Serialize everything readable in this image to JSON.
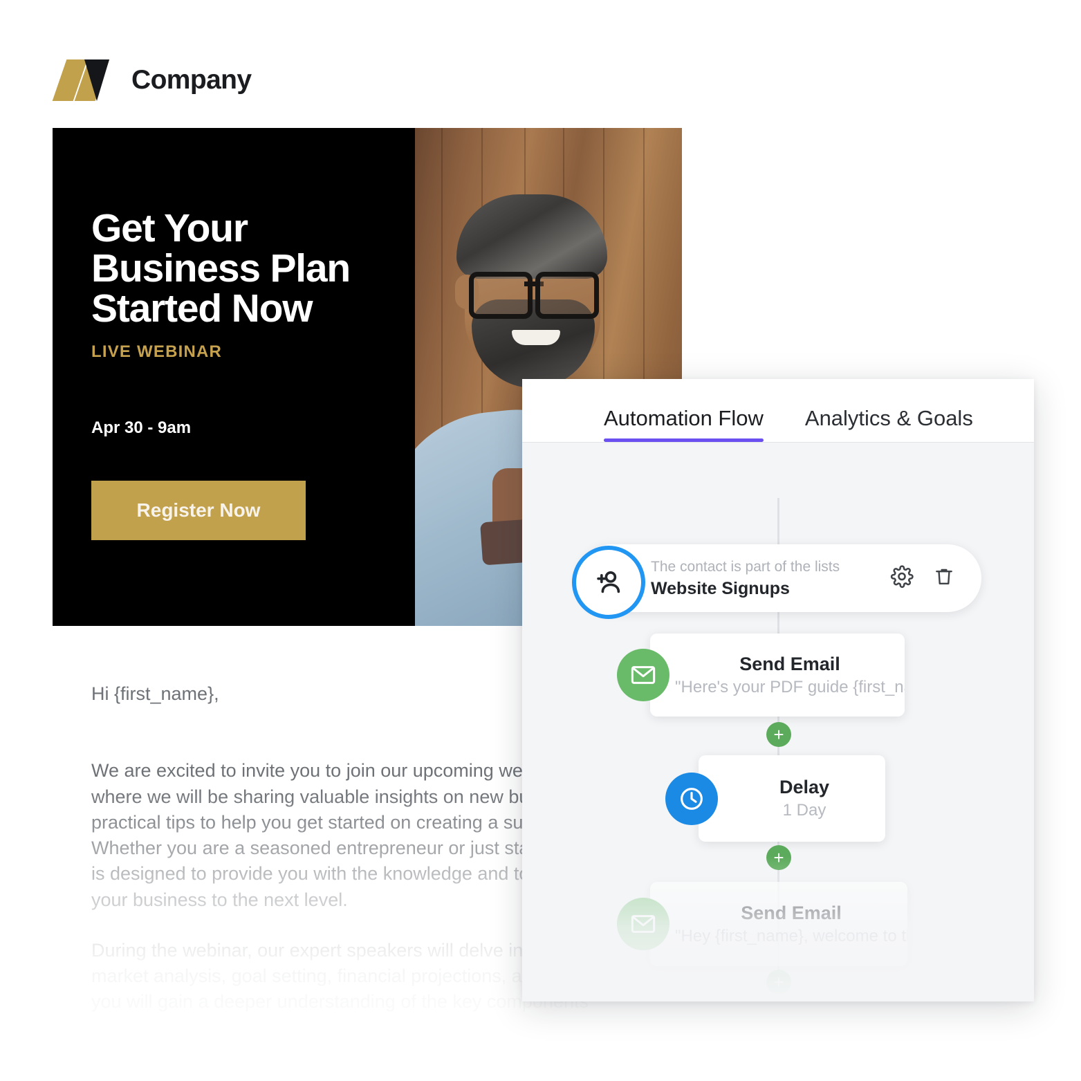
{
  "brand": {
    "name": "Company",
    "logo_gold": "#c2a14d",
    "logo_dark": "#15161a"
  },
  "email": {
    "hero": {
      "heading": "Get Your\nBusiness\nPlan Started\nNow",
      "kicker": "LIVE WEBINAR",
      "date": "Apr 30 - 9am",
      "cta_label": "Register Now",
      "cta_color": "#c2a14d",
      "background": "#000000"
    },
    "body": {
      "greeting": "Hi {first_name},",
      "paragraph_1": "We are excited to invite you to join our upcoming webinar on\nwhere we will be sharing valuable insights on new business\npractical tips to help you get started on creating a successfu\nWhether you are a seasoned entrepreneur or just starting ou\nis designed to provide you with the knowledge and tools you\nyour business to the next level.",
      "paragraph_2": "During the webinar, our expert speakers will delve into topics\nmarket analysis, goal setting, financial projections, and more\nyou will gain a deeper understanding of the key components"
    }
  },
  "automation": {
    "tabs": [
      {
        "label": "Automation Flow",
        "active": true
      },
      {
        "label": "Analytics & Goals",
        "active": false
      }
    ],
    "active_tab_color": "#6c4ff0",
    "trigger": {
      "subtitle": "The contact is part of the lists",
      "title": "Website Signups",
      "icon": "add-person-icon",
      "icon_color": "#2196f3",
      "settings_icon": "gear-icon",
      "delete_icon": "trash-icon"
    },
    "steps": [
      {
        "title": "Send Email",
        "subtitle": "\"Here's your PDF guide {first_na...",
        "icon": "envelope-icon",
        "badge_color": "#69bb6a"
      },
      {
        "title": "Delay",
        "subtitle": "1 Day",
        "icon": "clock-icon",
        "badge_color": "#1a8ae5"
      },
      {
        "title": "Send Email",
        "subtitle": "\"Hey {first_name}, welcome to th...",
        "icon": "envelope-icon",
        "badge_color": "#8dce8e"
      }
    ],
    "add_step_label": "+",
    "add_step_color": "#5cab5c"
  }
}
